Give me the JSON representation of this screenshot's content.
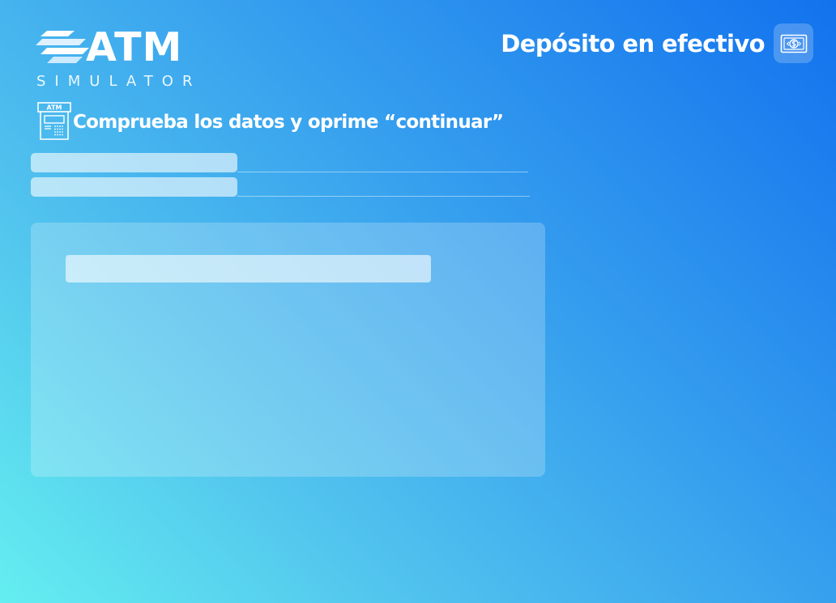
{
  "logo": {
    "brand": "ATM",
    "subtitle": "SIMULATOR"
  },
  "header": {
    "title": "Depósito en efectivo",
    "icon": "cash-banknote-icon"
  },
  "instruction": {
    "icon": "atm-machine-icon",
    "atm_label": "ATM",
    "text": "Comprueba los datos y oprime “continuar”"
  }
}
